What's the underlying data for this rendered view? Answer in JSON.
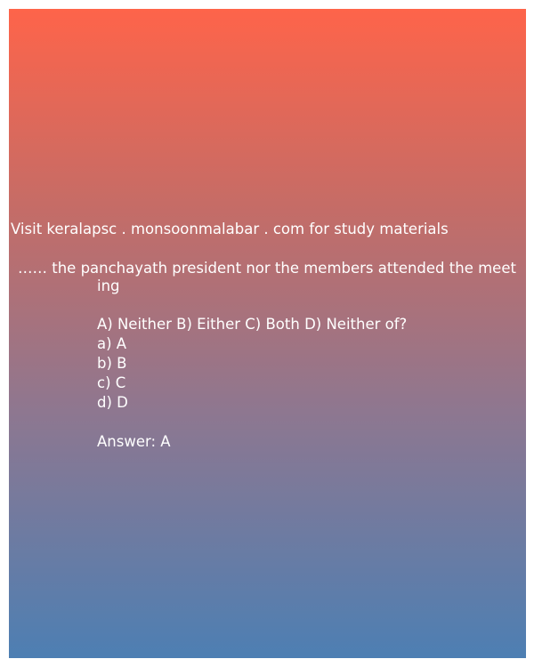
{
  "header": {
    "site_text": "Visit keralapsc . monsoonmalabar . com for study materials"
  },
  "question": {
    "line1": "…… the panchayath president nor the members attended the meet",
    "line2": "ing",
    "choices": "A) Neither  B) Either  C) Both  D) Neither of?"
  },
  "options": [
    "a) A",
    "b) B",
    "c) C",
    "d) D"
  ],
  "answer": "Answer: A",
  "colors": {
    "gradient_top": "#fe644a",
    "gradient_bottom": "#4d7fb3",
    "text": "#ffffff"
  }
}
